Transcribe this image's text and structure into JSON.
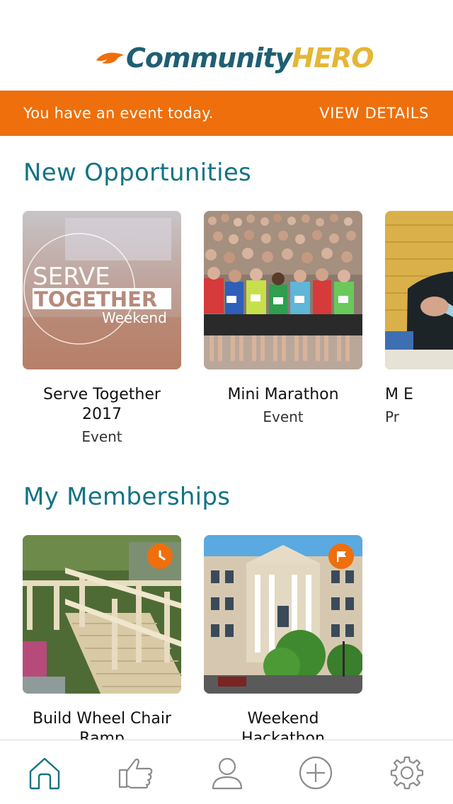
{
  "app": {
    "logo_community": "Community",
    "logo_hero": "HERO"
  },
  "banner": {
    "message": "You have an event today.",
    "action": "VIEW DETAILS"
  },
  "sections": {
    "opportunities": {
      "title": "New Opportunities",
      "items": [
        {
          "title": "Serve Together 2017",
          "type": "Event",
          "art": {
            "line1": "SERVE",
            "line2": "TOGETHER",
            "line3": "Weekend"
          }
        },
        {
          "title": "Mini Marathon",
          "type": "Event"
        },
        {
          "title": "M E",
          "type": "Pr"
        }
      ]
    },
    "memberships": {
      "title": "My Memberships",
      "items": [
        {
          "title": "Build Wheel Chair Ramp",
          "badge_icon": "clock-icon"
        },
        {
          "title": "Weekend Hackathon",
          "badge_icon": "flag-icon"
        }
      ]
    }
  },
  "tabbar": {
    "tabs": [
      {
        "icon": "home-icon",
        "active": true
      },
      {
        "icon": "thumbs-up-icon",
        "active": false
      },
      {
        "icon": "profile-icon",
        "active": false
      },
      {
        "icon": "plus-circle-icon",
        "active": false
      },
      {
        "icon": "gear-icon",
        "active": false
      }
    ]
  },
  "colors": {
    "accent": "#ee6f0c",
    "heading": "#137385",
    "logo_blue": "#1f5f73",
    "logo_gold": "#e5b636"
  }
}
